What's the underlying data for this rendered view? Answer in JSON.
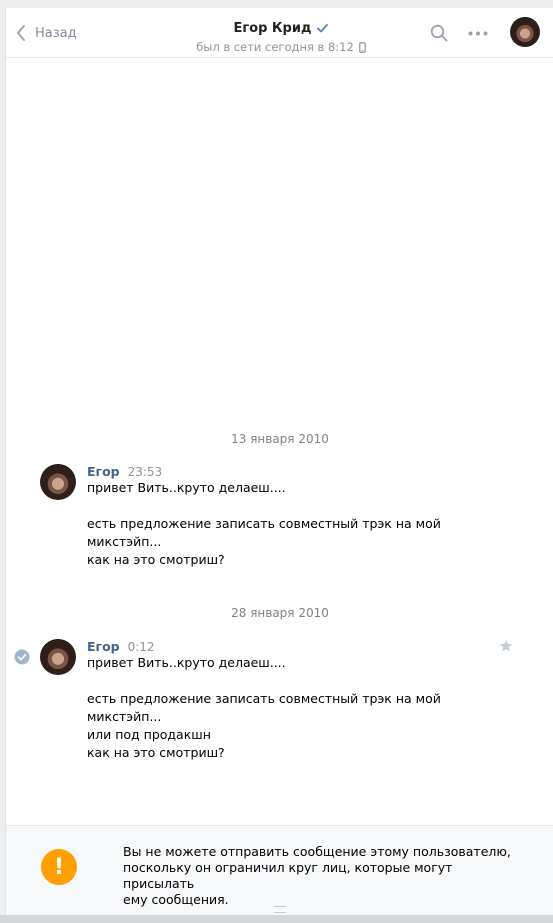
{
  "header": {
    "back_label": "Назад",
    "title": "Егор Крид",
    "status": "был в сети сегодня в 8:12"
  },
  "messages": [
    {
      "date": "13 января 2010",
      "author": "Егор",
      "time": "23:53",
      "lines": [
        "привет Вить..круто делаеш....",
        "",
        "есть предложение записать совместный трэк на мой",
        "микстэйп...",
        "как на это смотриш?"
      ]
    },
    {
      "date": "28 января 2010",
      "author": "Егор",
      "time": "0:12",
      "lines": [
        "привет Вить..круто делаеш....",
        "",
        "есть предложение записать совместный трэк на мой",
        "микстэйп...",
        "или под продакшн",
        "как на это смотриш?"
      ]
    }
  ],
  "footer": {
    "icon": "!",
    "lines": [
      "Вы не можете отправить сообщение этому пользователю,",
      "поскольку он ограничил круг лиц, которые могут присылать",
      "ему сообщения."
    ]
  },
  "colors": {
    "accent": "#42648b",
    "warning": "#ffa000",
    "verified": "#5181b8"
  },
  "icons": [
    "back-chevron-icon",
    "verified-icon",
    "phone-icon",
    "search-icon",
    "more-icon",
    "read-check-icon",
    "star-icon",
    "warning-icon"
  ]
}
